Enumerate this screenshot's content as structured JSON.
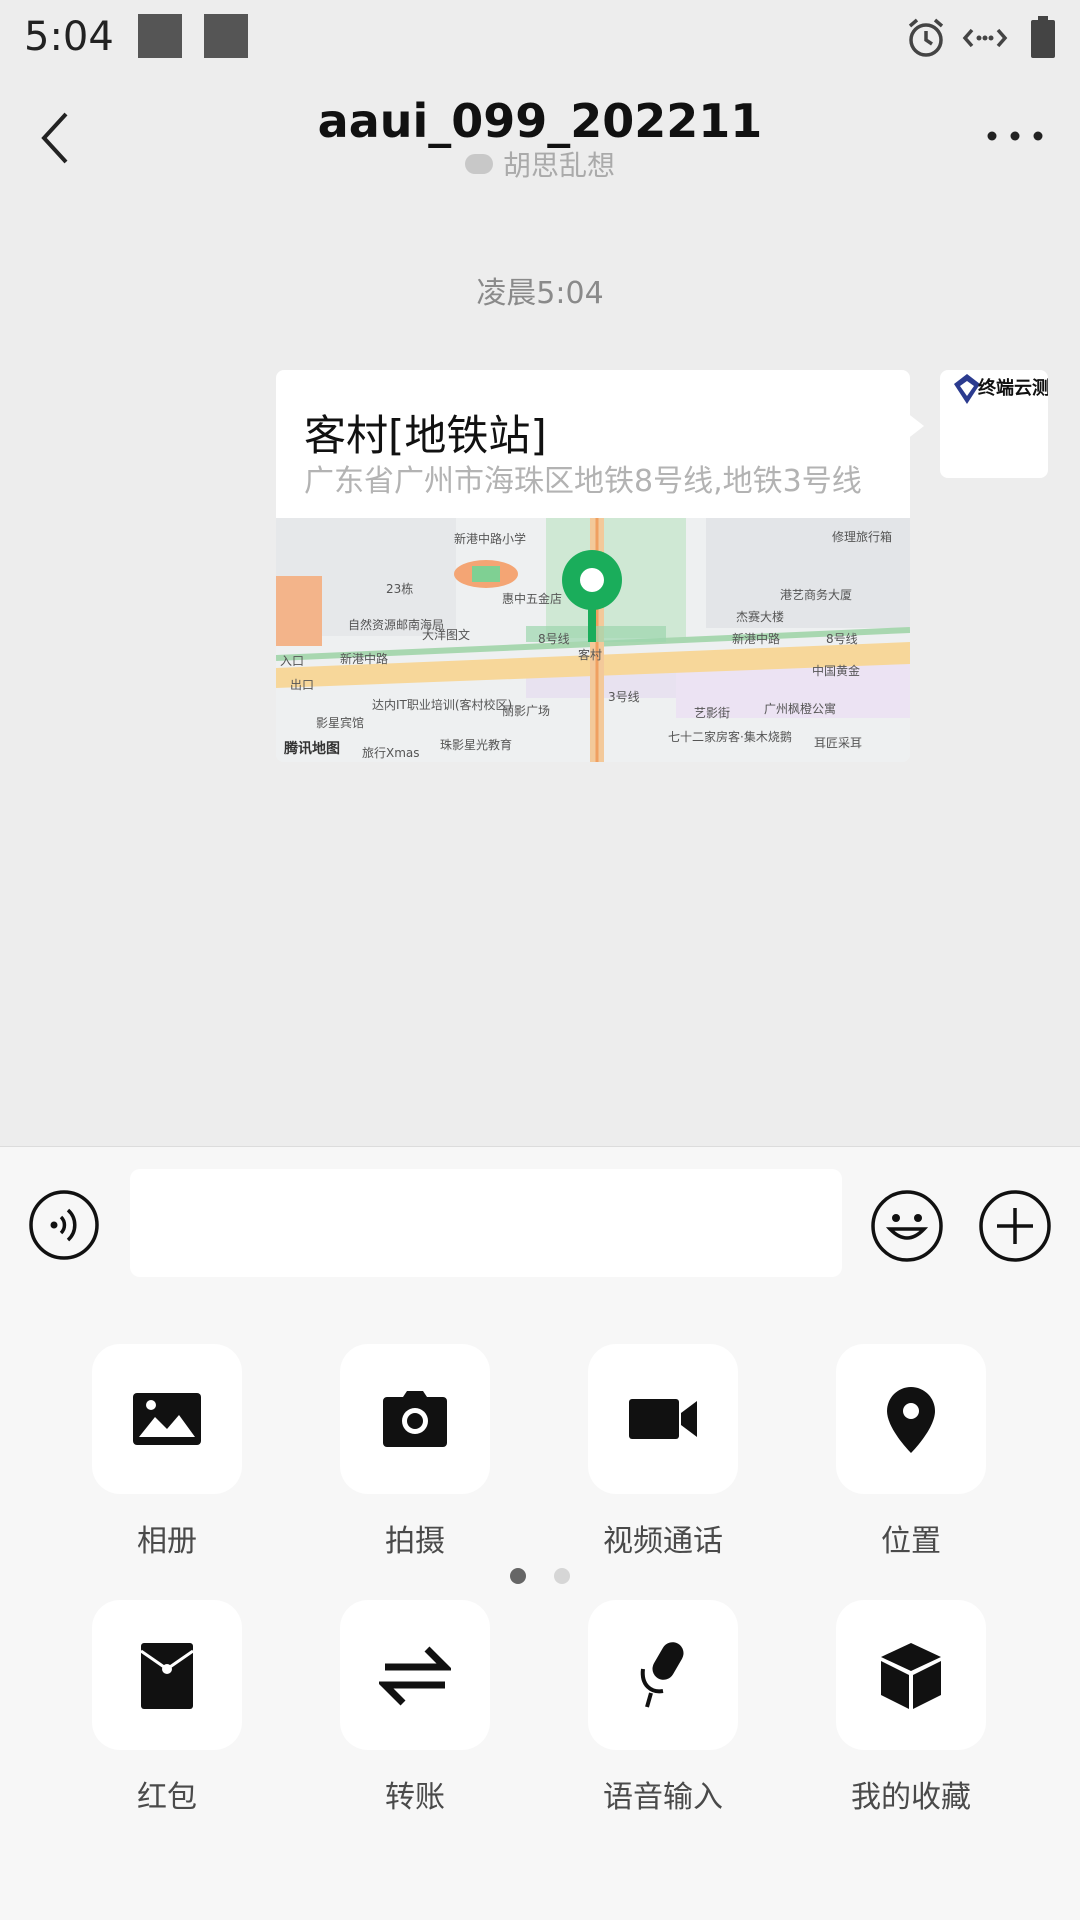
{
  "status_bar": {
    "time": "5:04"
  },
  "header": {
    "title": "aaui_099_202211",
    "status": "胡思乱想"
  },
  "conversation": {
    "timestamp": "凌晨5:04",
    "message": {
      "type": "location",
      "name": "客村[地铁站]",
      "address": "广东省广州市海珠区地铁8号线,地铁3号线",
      "map": {
        "brand": "腾讯地图",
        "pin_color": "#1aad5b",
        "labels": [
          "新港中路小学",
          "修理旅行箱",
          "23栋",
          "惠中五金店",
          "港艺商务大厦",
          "杰赛大楼",
          "自然资源邮南海局",
          "大洋图文",
          "8号线",
          "客村",
          "新港中路",
          "8号线",
          "中国黄金",
          "新港中路",
          "入口",
          "出口",
          "达内IT职业培训(客村校区)",
          "丽影广场",
          "艺影街",
          "广州枫橙公寓",
          "影星宾馆",
          "珠影星光教育",
          "七十二家房客·集木烧鹅",
          "耳匠采耳",
          "旅行Xmas",
          "3号线"
        ]
      }
    },
    "avatar_text": "终端云测"
  },
  "input_bar": {
    "placeholder": ""
  },
  "tools": [
    {
      "label": "相册",
      "icon": "photo-album-icon"
    },
    {
      "label": "拍摄",
      "icon": "camera-icon"
    },
    {
      "label": "视频通话",
      "icon": "video-call-icon"
    },
    {
      "label": "位置",
      "icon": "location-pin-icon"
    },
    {
      "label": "红包",
      "icon": "red-packet-icon"
    },
    {
      "label": "转账",
      "icon": "transfer-icon"
    },
    {
      "label": "语音输入",
      "icon": "microphone-icon"
    },
    {
      "label": "我的收藏",
      "icon": "favorites-box-icon"
    }
  ],
  "pager": {
    "pages": 2,
    "active": 1
  },
  "colors": {
    "accent": "#1aad5b",
    "background": "#ededed",
    "panel": "#f7f7f7"
  }
}
